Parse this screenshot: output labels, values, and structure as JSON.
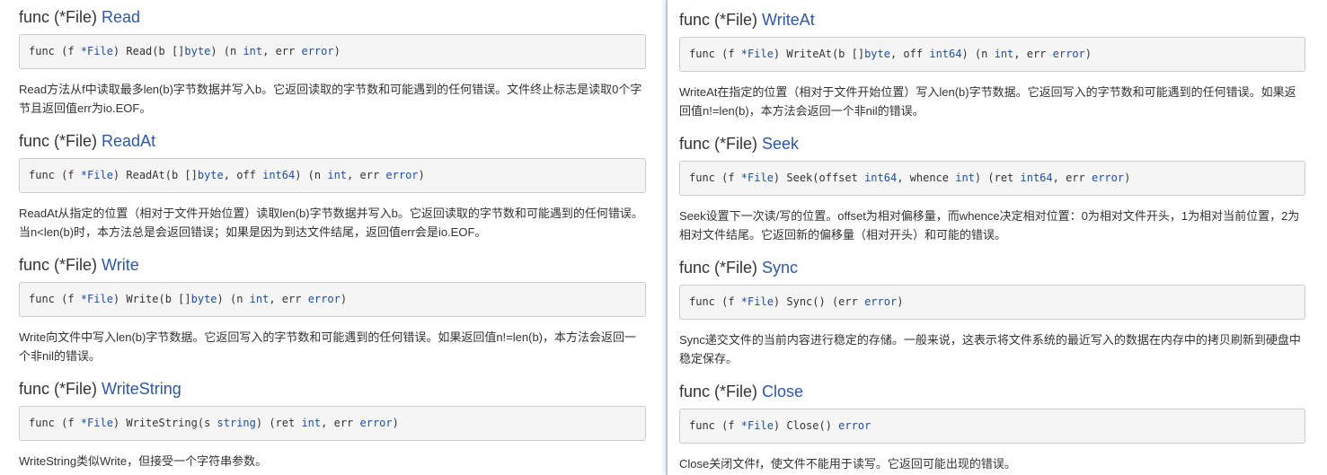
{
  "left": [
    {
      "func_prefix": "func (*File) ",
      "name": "Read",
      "sig_pre": "func (f *File) Read(b []byte) (n ",
      "sig_parts": [
        {
          "t": "func (f ",
          "c": ""
        },
        {
          "t": "*File",
          "c": "ty"
        },
        {
          "t": ") Read(b []",
          "c": ""
        },
        {
          "t": "byte",
          "c": "ty"
        },
        {
          "t": ") (n ",
          "c": ""
        },
        {
          "t": "int",
          "c": "ty"
        },
        {
          "t": ", err ",
          "c": ""
        },
        {
          "t": "error",
          "c": "ty"
        },
        {
          "t": ")",
          "c": ""
        }
      ],
      "desc": "Read方法从f中读取最多len(b)字节数据并写入b。它返回读取的字节数和可能遇到的任何错误。文件终止标志是读取0个字节且返回值err为io.EOF。"
    },
    {
      "func_prefix": "func (*File) ",
      "name": "ReadAt",
      "sig_parts": [
        {
          "t": "func (f ",
          "c": ""
        },
        {
          "t": "*File",
          "c": "ty"
        },
        {
          "t": ") ReadAt(b []",
          "c": ""
        },
        {
          "t": "byte",
          "c": "ty"
        },
        {
          "t": ", off ",
          "c": ""
        },
        {
          "t": "int64",
          "c": "ty"
        },
        {
          "t": ") (n ",
          "c": ""
        },
        {
          "t": "int",
          "c": "ty"
        },
        {
          "t": ", err ",
          "c": ""
        },
        {
          "t": "error",
          "c": "ty"
        },
        {
          "t": ")",
          "c": ""
        }
      ],
      "desc": "ReadAt从指定的位置（相对于文件开始位置）读取len(b)字节数据并写入b。它返回读取的字节数和可能遇到的任何错误。当n<len(b)时，本方法总是会返回错误；如果是因为到达文件结尾，返回值err会是io.EOF。"
    },
    {
      "func_prefix": "func (*File) ",
      "name": "Write",
      "sig_parts": [
        {
          "t": "func (f ",
          "c": ""
        },
        {
          "t": "*File",
          "c": "ty"
        },
        {
          "t": ") Write(b []",
          "c": ""
        },
        {
          "t": "byte",
          "c": "ty"
        },
        {
          "t": ") (n ",
          "c": ""
        },
        {
          "t": "int",
          "c": "ty"
        },
        {
          "t": ", err ",
          "c": ""
        },
        {
          "t": "error",
          "c": "ty"
        },
        {
          "t": ")",
          "c": ""
        }
      ],
      "desc": "Write向文件中写入len(b)字节数据。它返回写入的字节数和可能遇到的任何错误。如果返回值n!=len(b)，本方法会返回一个非nil的错误。"
    },
    {
      "func_prefix": "func (*File) ",
      "name": "WriteString",
      "sig_parts": [
        {
          "t": "func (f ",
          "c": ""
        },
        {
          "t": "*File",
          "c": "ty"
        },
        {
          "t": ") WriteString(s ",
          "c": ""
        },
        {
          "t": "string",
          "c": "ty"
        },
        {
          "t": ") (ret ",
          "c": ""
        },
        {
          "t": "int",
          "c": "ty"
        },
        {
          "t": ", err ",
          "c": ""
        },
        {
          "t": "error",
          "c": "ty"
        },
        {
          "t": ")",
          "c": ""
        }
      ],
      "desc": "WriteString类似Write，但接受一个字符串参数。"
    }
  ],
  "right": [
    {
      "func_prefix": "func (*File) ",
      "name": "WriteAt",
      "sig_parts": [
        {
          "t": "func (f ",
          "c": ""
        },
        {
          "t": "*File",
          "c": "ty"
        },
        {
          "t": ") WriteAt(b []",
          "c": ""
        },
        {
          "t": "byte",
          "c": "ty"
        },
        {
          "t": ", off ",
          "c": ""
        },
        {
          "t": "int64",
          "c": "ty"
        },
        {
          "t": ") (n ",
          "c": ""
        },
        {
          "t": "int",
          "c": "ty"
        },
        {
          "t": ", err ",
          "c": ""
        },
        {
          "t": "error",
          "c": "ty"
        },
        {
          "t": ")",
          "c": ""
        }
      ],
      "desc": "WriteAt在指定的位置（相对于文件开始位置）写入len(b)字节数据。它返回写入的字节数和可能遇到的任何错误。如果返回值n!=len(b)，本方法会返回一个非nil的错误。"
    },
    {
      "func_prefix": "func (*File) ",
      "name": "Seek",
      "sig_parts": [
        {
          "t": "func (f ",
          "c": ""
        },
        {
          "t": "*File",
          "c": "ty"
        },
        {
          "t": ") Seek(offset ",
          "c": ""
        },
        {
          "t": "int64",
          "c": "ty"
        },
        {
          "t": ", whence ",
          "c": ""
        },
        {
          "t": "int",
          "c": "ty"
        },
        {
          "t": ") (ret ",
          "c": ""
        },
        {
          "t": "int64",
          "c": "ty"
        },
        {
          "t": ", err ",
          "c": ""
        },
        {
          "t": "error",
          "c": "ty"
        },
        {
          "t": ")",
          "c": ""
        }
      ],
      "desc": "Seek设置下一次读/写的位置。offset为相对偏移量，而whence决定相对位置：0为相对文件开头，1为相对当前位置，2为相对文件结尾。它返回新的偏移量（相对开头）和可能的错误。"
    },
    {
      "func_prefix": "func (*File) ",
      "name": "Sync",
      "sig_parts": [
        {
          "t": "func (f ",
          "c": ""
        },
        {
          "t": "*File",
          "c": "ty"
        },
        {
          "t": ") Sync() (err ",
          "c": ""
        },
        {
          "t": "error",
          "c": "ty"
        },
        {
          "t": ")",
          "c": ""
        }
      ],
      "desc": "Sync递交文件的当前内容进行稳定的存储。一般来说，这表示将文件系统的最近写入的数据在内存中的拷贝刷新到硬盘中稳定保存。"
    },
    {
      "func_prefix": "func (*File) ",
      "name": "Close",
      "sig_parts": [
        {
          "t": "func (f ",
          "c": ""
        },
        {
          "t": "*File",
          "c": "ty"
        },
        {
          "t": ") Close() ",
          "c": ""
        },
        {
          "t": "error",
          "c": "ty"
        }
      ],
      "desc": "Close关闭文件f，使文件不能用于读写。它返回可能出现的错误。"
    }
  ]
}
